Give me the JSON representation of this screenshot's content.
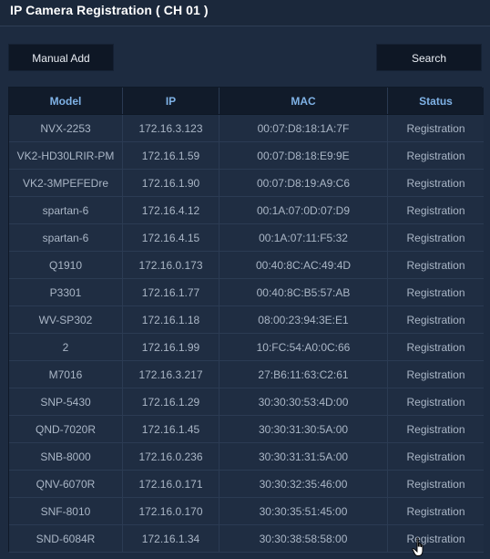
{
  "header": {
    "title": "IP Camera Registration ( CH 01 )"
  },
  "toolbar": {
    "manual_add_label": "Manual Add",
    "search_label": "Search"
  },
  "table": {
    "columns": [
      "Model",
      "IP",
      "MAC",
      "Status"
    ],
    "rows": [
      {
        "model": "NVX-2253",
        "ip": "172.16.3.123",
        "mac": "00:07:D8:18:1A:7F",
        "status": "Registration"
      },
      {
        "model": "VK2-HD30LRIR-PM",
        "ip": "172.16.1.59",
        "mac": "00:07:D8:18:E9:9E",
        "status": "Registration"
      },
      {
        "model": "VK2-3MPEFEDre",
        "ip": "172.16.1.90",
        "mac": "00:07:D8:19:A9:C6",
        "status": "Registration"
      },
      {
        "model": "spartan-6",
        "ip": "172.16.4.12",
        "mac": "00:1A:07:0D:07:D9",
        "status": "Registration"
      },
      {
        "model": "spartan-6",
        "ip": "172.16.4.15",
        "mac": "00:1A:07:11:F5:32",
        "status": "Registration"
      },
      {
        "model": "Q1910",
        "ip": "172.16.0.173",
        "mac": "00:40:8C:AC:49:4D",
        "status": "Registration"
      },
      {
        "model": "P3301",
        "ip": "172.16.1.77",
        "mac": "00:40:8C:B5:57:AB",
        "status": "Registration"
      },
      {
        "model": "WV-SP302",
        "ip": "172.16.1.18",
        "mac": "08:00:23:94:3E:E1",
        "status": "Registration"
      },
      {
        "model": "2",
        "ip": "172.16.1.99",
        "mac": "10:FC:54:A0:0C:66",
        "status": "Registration"
      },
      {
        "model": "M7016",
        "ip": "172.16.3.217",
        "mac": "27:B6:11:63:C2:61",
        "status": "Registration"
      },
      {
        "model": "SNP-5430",
        "ip": "172.16.1.29",
        "mac": "30:30:30:53:4D:00",
        "status": "Registration"
      },
      {
        "model": "QND-7020R",
        "ip": "172.16.1.45",
        "mac": "30:30:31:30:5A:00",
        "status": "Registration"
      },
      {
        "model": "SNB-8000",
        "ip": "172.16.0.236",
        "mac": "30:30:31:31:5A:00",
        "status": "Registration"
      },
      {
        "model": "QNV-6070R",
        "ip": "172.16.0.171",
        "mac": "30:30:32:35:46:00",
        "status": "Registration"
      },
      {
        "model": "SNF-8010",
        "ip": "172.16.0.170",
        "mac": "30:30:35:51:45:00",
        "status": "Registration"
      },
      {
        "model": "SND-6084R",
        "ip": "172.16.1.34",
        "mac": "30:30:38:58:58:00",
        "status": "Registration"
      }
    ]
  },
  "icons": {
    "cursor": "hand-pointer-icon"
  }
}
